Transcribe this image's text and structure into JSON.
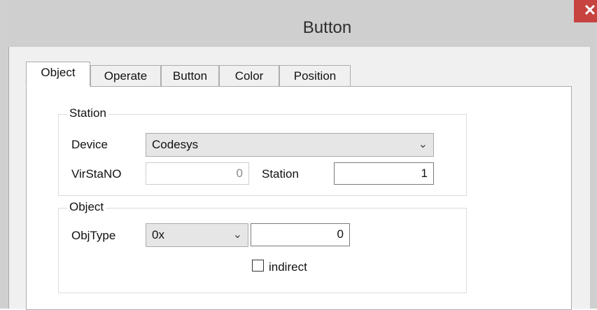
{
  "window": {
    "title": "Button",
    "close_glyph": "✕"
  },
  "tabs": [
    {
      "label": "Object",
      "active": true
    },
    {
      "label": "Operate",
      "active": false
    },
    {
      "label": "Button",
      "active": false
    },
    {
      "label": "Color",
      "active": false
    },
    {
      "label": "Position",
      "active": false
    }
  ],
  "station_group": {
    "title": "Station",
    "device_label": "Device",
    "device_value": "Codesys",
    "virstano_label": "VirStaNO",
    "virstano_value": "0",
    "station_label": "Station",
    "station_value": "1"
  },
  "object_group": {
    "title": "Object",
    "objtype_label": "ObjType",
    "objtype_value": "0x",
    "address_value": "0",
    "indirect_label": "indirect",
    "indirect_checked": false
  },
  "icons": {
    "dropdown": "chevron-down-icon",
    "close": "close-icon"
  }
}
